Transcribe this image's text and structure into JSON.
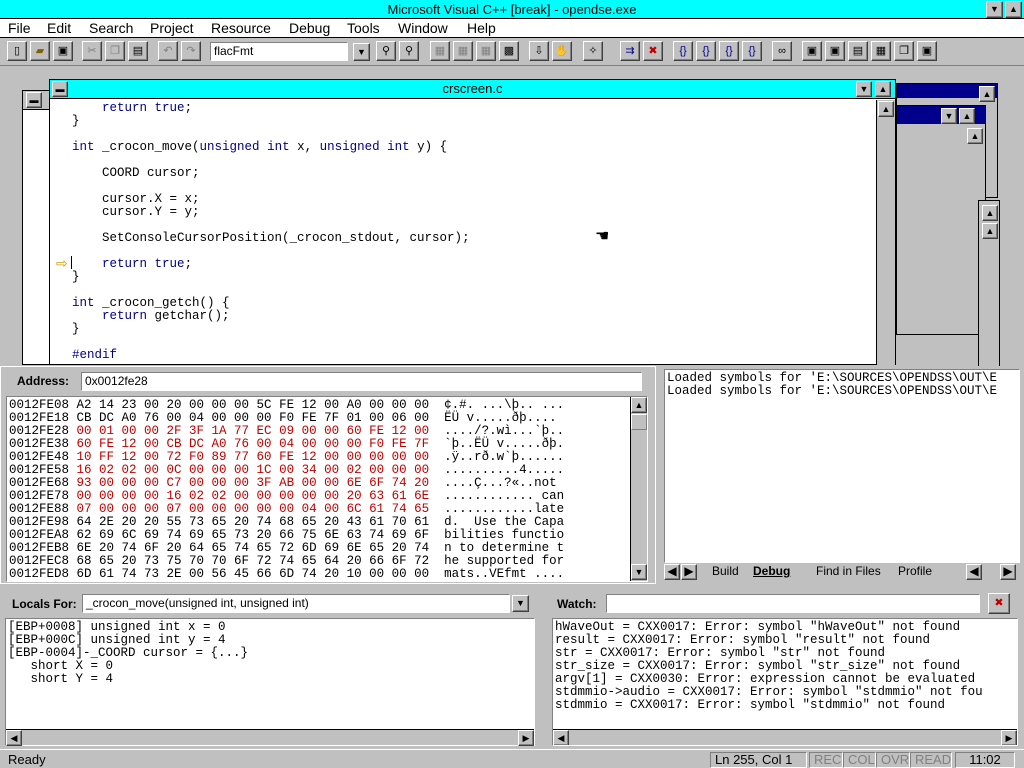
{
  "app": {
    "title": "Microsoft Visual C++ [break] - opendse.exe"
  },
  "menu": {
    "items": [
      "File",
      "Edit",
      "Search",
      "Project",
      "Resource",
      "Debug",
      "Tools",
      "Window",
      "Help"
    ]
  },
  "toolbar": {
    "find_combo_value": "flacFmt"
  },
  "editor": {
    "title": "crscreen.c",
    "lines": [
      "    return true;",
      "}",
      "",
      "int _crocon_move(unsigned int x, unsigned int y) {",
      "",
      "    COORD cursor;",
      "",
      "    cursor.X = x;",
      "    cursor.Y = y;",
      "",
      "    SetConsoleCursorPosition(_crocon_stdout, cursor);",
      "",
      "    return true;",
      "}",
      "",
      "int _crocon_getch() {",
      "    return getchar();",
      "}",
      "",
      "#endif"
    ]
  },
  "memory": {
    "address_label": "Address:",
    "address_value": "0x0012fe28",
    "rows": [
      {
        "addr": "0012FE08",
        "hex": "A2 14 23 00 20 00 00 00 5C FE 12 00 A0 00 00 00",
        "ascii": "¢.#. ...\\þ.. ...",
        "changed": false
      },
      {
        "addr": "0012FE18",
        "hex": "CB DC A0 76 00 04 00 00 00 F0 FE 7F 01 00 06 00",
        "ascii": "ËÜ v.....ðþ....",
        "changed": false
      },
      {
        "addr": "0012FE28",
        "hex": "00 01 00 00 2F 3F 1A 77 EC 09 00 00 60 FE 12 00",
        "ascii": "..../?.wì...`þ..",
        "changed": true
      },
      {
        "addr": "0012FE38",
        "hex": "60 FE 12 00 CB DC A0 76 00 04 00 00 00 F0 FE 7F",
        "ascii": "`þ..ËÜ v.....ðþ.",
        "changed": true
      },
      {
        "addr": "0012FE48",
        "hex": "10 FF 12 00 72 F0 89 77 60 FE 12 00 00 00 00 00",
        "ascii": ".ÿ..rð.w`þ......",
        "changed": true
      },
      {
        "addr": "0012FE58",
        "hex": "16 02 02 00 0C 00 00 00 1C 00 34 00 02 00 00 00",
        "ascii": "..........4.....",
        "changed": true
      },
      {
        "addr": "0012FE68",
        "hex": "93 00 00 00 C7 00 00 00 3F AB 00 00 6E 6F 74 20",
        "ascii": "....Ç...?«..not ",
        "changed": true
      },
      {
        "addr": "0012FE78",
        "hex": "00 00 00 00 16 02 02 00 00 00 00 00 20 63 61 6E",
        "ascii": "............ can",
        "changed": true
      },
      {
        "addr": "0012FE88",
        "hex": "07 00 00 00 07 00 00 00 00 00 04 00 6C 61 74 65",
        "ascii": "............late",
        "changed": true
      },
      {
        "addr": "0012FE98",
        "hex": "64 2E 20 20 55 73 65 20 74 68 65 20 43 61 70 61",
        "ascii": "d.  Use the Capa",
        "changed": false
      },
      {
        "addr": "0012FEA8",
        "hex": "62 69 6C 69 74 69 65 73 20 66 75 6E 63 74 69 6F",
        "ascii": "bilities functio",
        "changed": false
      },
      {
        "addr": "0012FEB8",
        "hex": "6E 20 74 6F 20 64 65 74 65 72 6D 69 6E 65 20 74",
        "ascii": "n to determine t",
        "changed": false
      },
      {
        "addr": "0012FEC8",
        "hex": "68 65 20 73 75 70 70 6F 72 74 65 64 20 66 6F 72",
        "ascii": "he supported for",
        "changed": false
      },
      {
        "addr": "0012FED8",
        "hex": "6D 61 74 73 2E 00 56 45 66 6D 74 20 10 00 00 00",
        "ascii": "mats..VEfmt ....",
        "changed": false
      }
    ]
  },
  "output": {
    "lines": [
      "Loaded symbols for 'E:\\SOURCES\\OPENDSS\\OUT\\E",
      "Loaded symbols for 'E:\\SOURCES\\OPENDSS\\OUT\\E"
    ],
    "tabs": [
      "Build",
      "Debug",
      "Find in Files",
      "Profile"
    ],
    "active_tab": "Debug"
  },
  "locals": {
    "label": "Locals For:",
    "context": "_crocon_move(unsigned int, unsigned int)",
    "lines": [
      "[EBP+0008] unsigned int x = 0",
      "[EBP+000C] unsigned int y = 4",
      "[EBP-0004]-_COORD cursor = {...}",
      "   short X = 0",
      "   short Y = 4"
    ]
  },
  "watch": {
    "label": "Watch:",
    "input_value": "",
    "lines": [
      "hWaveOut = CXX0017: Error: symbol \"hWaveOut\" not found",
      "result = CXX0017: Error: symbol \"result\" not found",
      "str = CXX0017: Error: symbol \"str\" not found",
      "str_size = CXX0017: Error: symbol \"str_size\" not found",
      "argv[1] = CXX0030: Error: expression cannot be evaluated",
      "stdmmio->audio = CXX0017: Error: symbol \"stdmmio\" not fou",
      "stdmmio = CXX0017: Error: symbol \"stdmmio\" not found"
    ]
  },
  "status": {
    "ready": "Ready",
    "position": "Ln 255, Col 1",
    "rec": "REC",
    "col": "COL",
    "ovr": "OVR",
    "read": "READ",
    "time": "11:02"
  }
}
